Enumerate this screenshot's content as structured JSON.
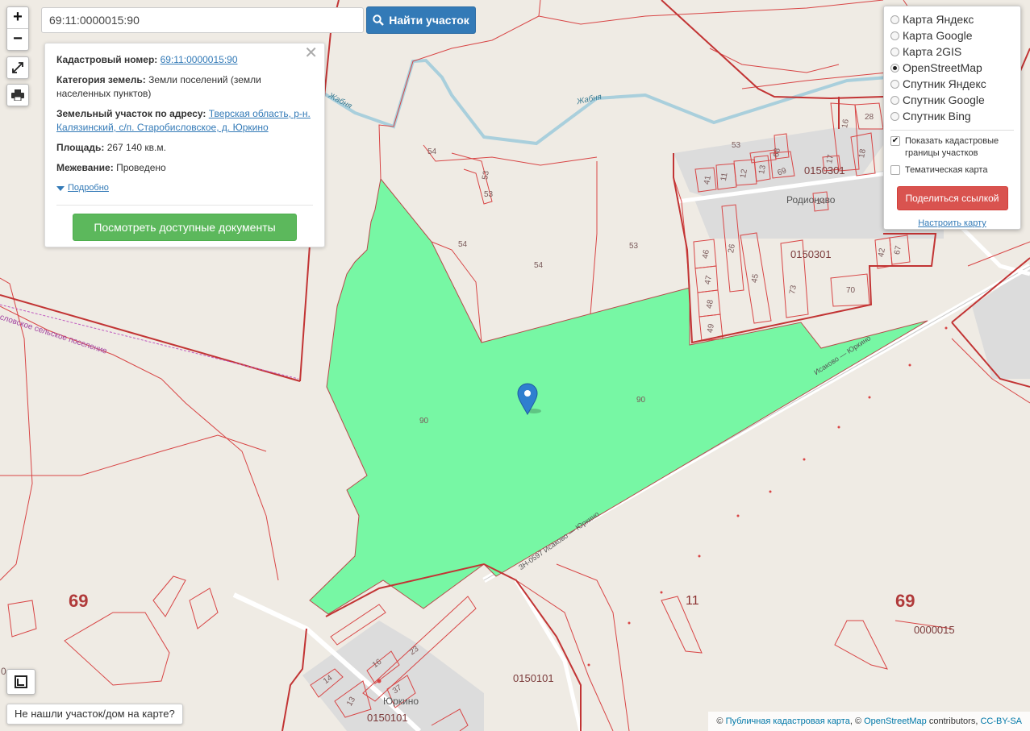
{
  "search": {
    "value": "69:11:0000015:90",
    "button_label": "Найти участок"
  },
  "info": {
    "cadastral_label": "Кадастровый номер:",
    "cadastral_value": "69:11:0000015:90",
    "category_label": "Категория земель:",
    "category_value": "Земли поселений (земли населенных пунктов)",
    "address_label": "Земельный участок по адресу:",
    "address_value": "Тверская область, р-н. Калязинский, с/п. Старобисловское, д. Юркино",
    "area_label": "Площадь:",
    "area_value": "267 140 кв.м.",
    "survey_label": "Межевание:",
    "survey_value": "Проведено",
    "more_label": "Подробно",
    "docs_button": "Посмотреть доступные документы"
  },
  "layers": {
    "options": [
      "Карта Яндекс",
      "Карта Google",
      "Карта 2GIS",
      "OpenStreetMap",
      "Спутник Яндекс",
      "Спутник Google",
      "Спутник Bing"
    ],
    "selected": "OpenStreetMap",
    "show_borders": "Показать кадастровые границы участков",
    "show_borders_checked": true,
    "thematic": "Тематическая карта",
    "thematic_checked": false,
    "share_button": "Поделиться ссылкой",
    "setup_link": "Настроить карту"
  },
  "zoom": {
    "in": "+",
    "out": "−"
  },
  "not_found": "Не нашли участок/дом на карте?",
  "attribution": {
    "copy1": "©",
    "link1": "Публичная кадастровая карта",
    "sep": ", ©",
    "link2": "OpenStreetMap",
    "contrib": "contributors,",
    "link3": "CC-BY-SA"
  },
  "map_labels": {
    "river": "Жабня",
    "river2": "Жабня",
    "border": "словское сельское поселение",
    "road": "Исаково — Юркино",
    "road2": "ЗН-0597 Исаково — Юркино",
    "village1": "Родионово",
    "village2": "Юркино",
    "q1": "0150301",
    "q2": "0150301",
    "q3": "0150101",
    "q4": "0150101",
    "q5": "0000015",
    "region1": "69",
    "region2": "69",
    "district": "11",
    "p90a": "90",
    "p90b": "90",
    "p54a": "54",
    "p54b": "54",
    "p54c": "54",
    "p53a": "53",
    "p53b": "53",
    "p53c": "53",
    "p53d": "53",
    "p16": "16",
    "p28": "28",
    "p18": "18",
    "p17": "17",
    "p68": "68",
    "p41": "41",
    "p11": "11",
    "p12": "12",
    "p13": "13",
    "p69": "69",
    "p14t": "14",
    "p46": "46",
    "p47": "47",
    "p48": "48",
    "p49": "49",
    "p26": "26",
    "p45": "45",
    "p73": "73",
    "p70": "70",
    "p42": "42",
    "p67": "67",
    "p14": "14",
    "p13b": "13",
    "p16b": "16",
    "p23": "23",
    "p37": "37",
    "edge0": "0"
  }
}
